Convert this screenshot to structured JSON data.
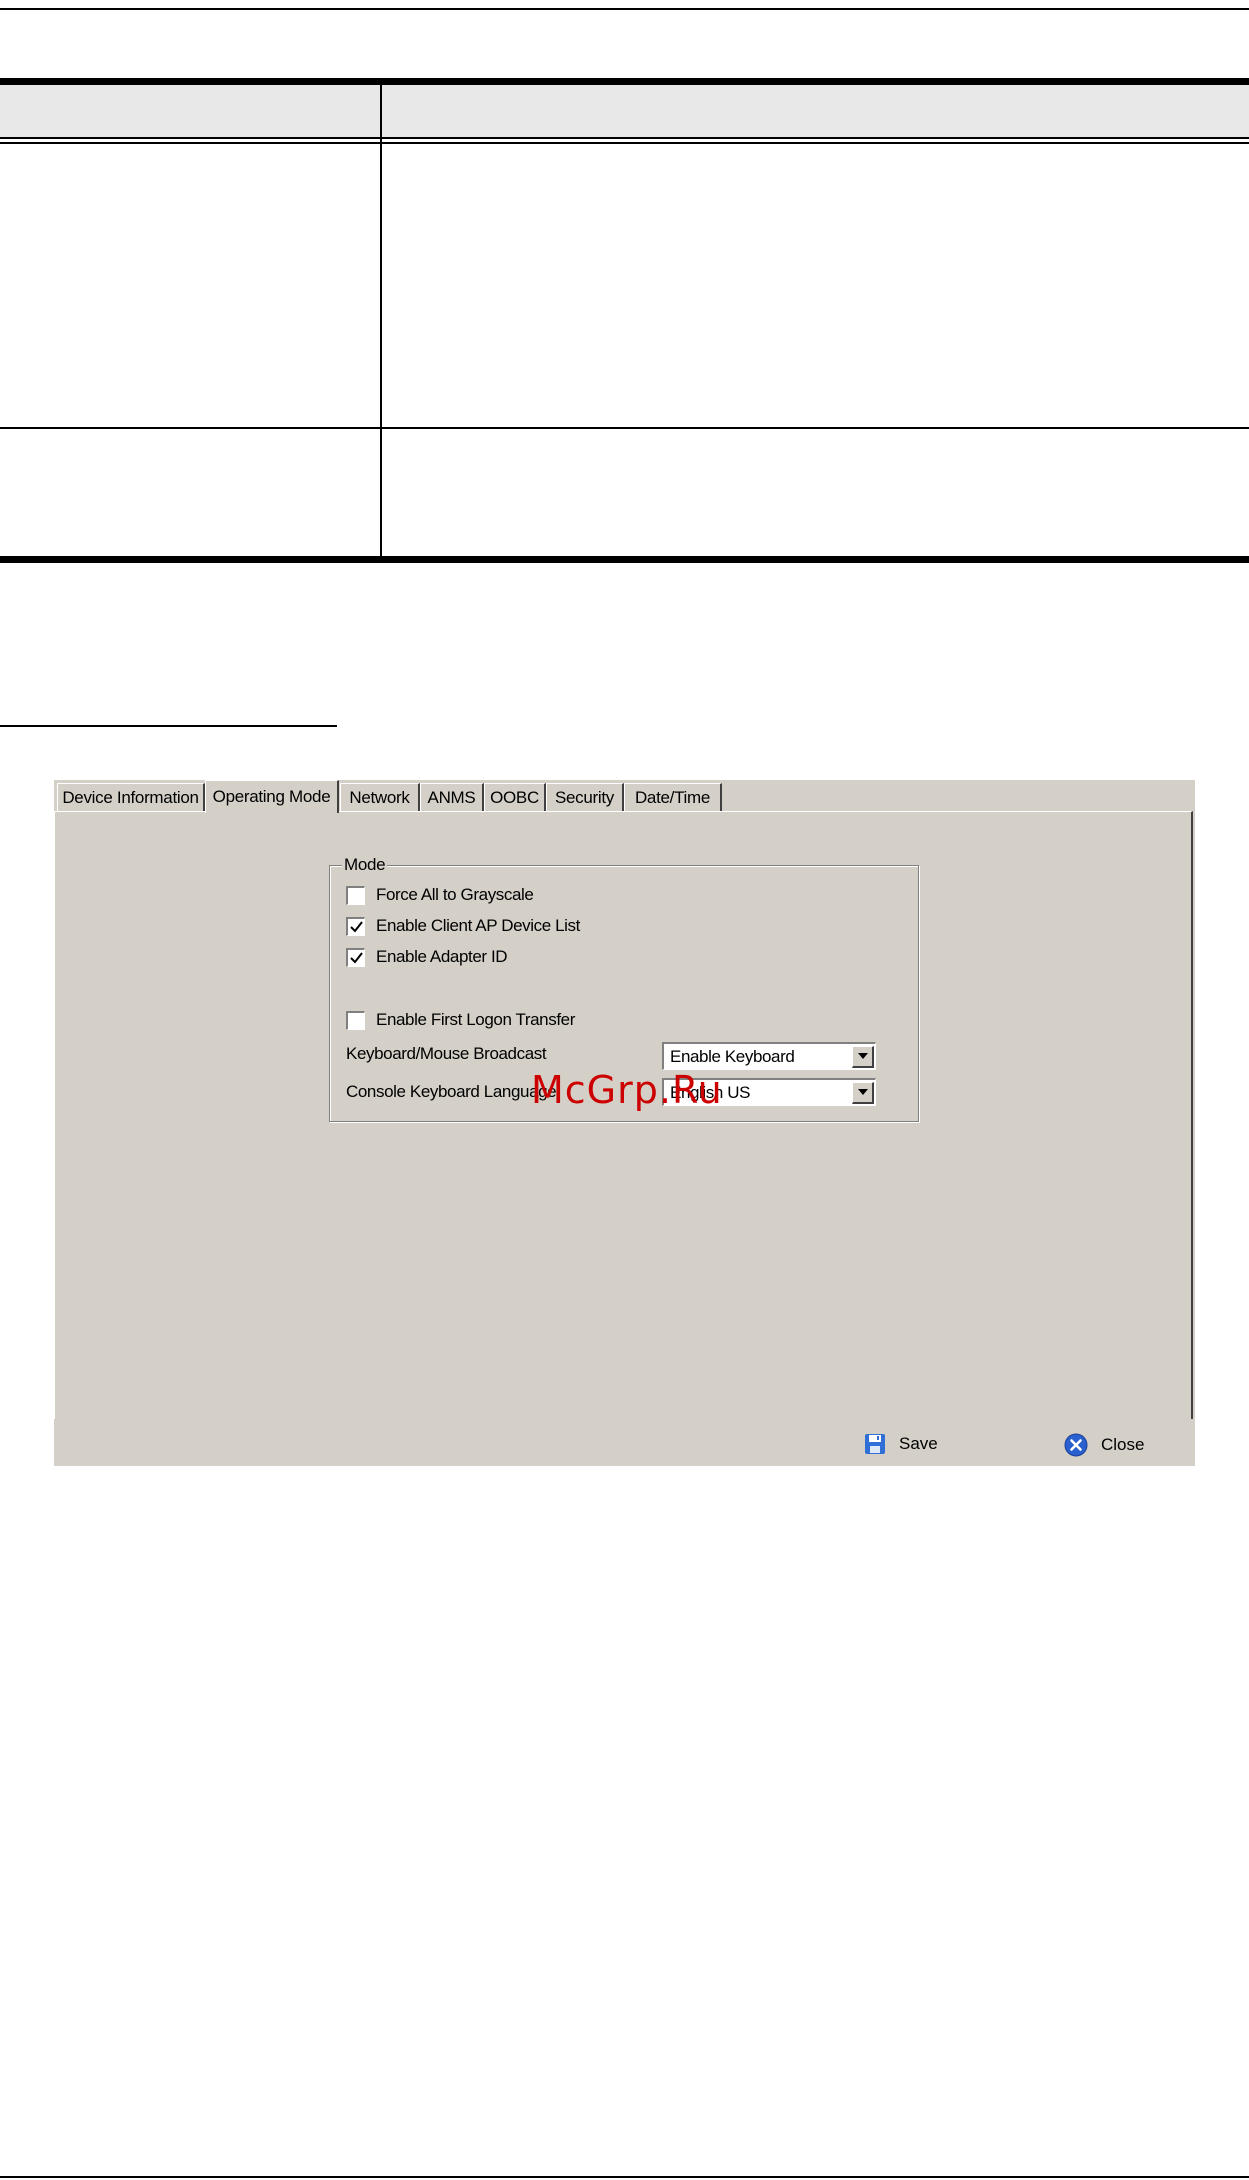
{
  "dialog": {
    "tabs": [
      {
        "label": "Device Information",
        "active": false
      },
      {
        "label": "Operating Mode",
        "active": true
      },
      {
        "label": "Network",
        "active": false
      },
      {
        "label": "ANMS",
        "active": false
      },
      {
        "label": "OOBC",
        "active": false
      },
      {
        "label": "Security",
        "active": false
      },
      {
        "label": "Date/Time",
        "active": false
      }
    ],
    "mode_group": {
      "title": "Mode",
      "checkboxes": [
        {
          "label": "Force All to Grayscale",
          "checked": false
        },
        {
          "label": "Enable Client AP Device List",
          "checked": true
        },
        {
          "label": "Enable Adapter ID",
          "checked": true
        },
        {
          "label": "Enable First Logon Transfer",
          "checked": false
        }
      ],
      "broadcast_label": "Keyboard/Mouse Broadcast",
      "broadcast_value": "Enable Keyboard",
      "language_label": "Console Keyboard Language",
      "language_value": "English US"
    },
    "actions": {
      "save_label": "Save",
      "close_label": "Close"
    }
  },
  "watermark": "McGrp.Ru",
  "colors": {
    "dialog_bg": "#d4d0c8",
    "save_icon": "#2f6fd6",
    "close_icon": "#2a5fcf",
    "watermark": "#cc0000"
  }
}
